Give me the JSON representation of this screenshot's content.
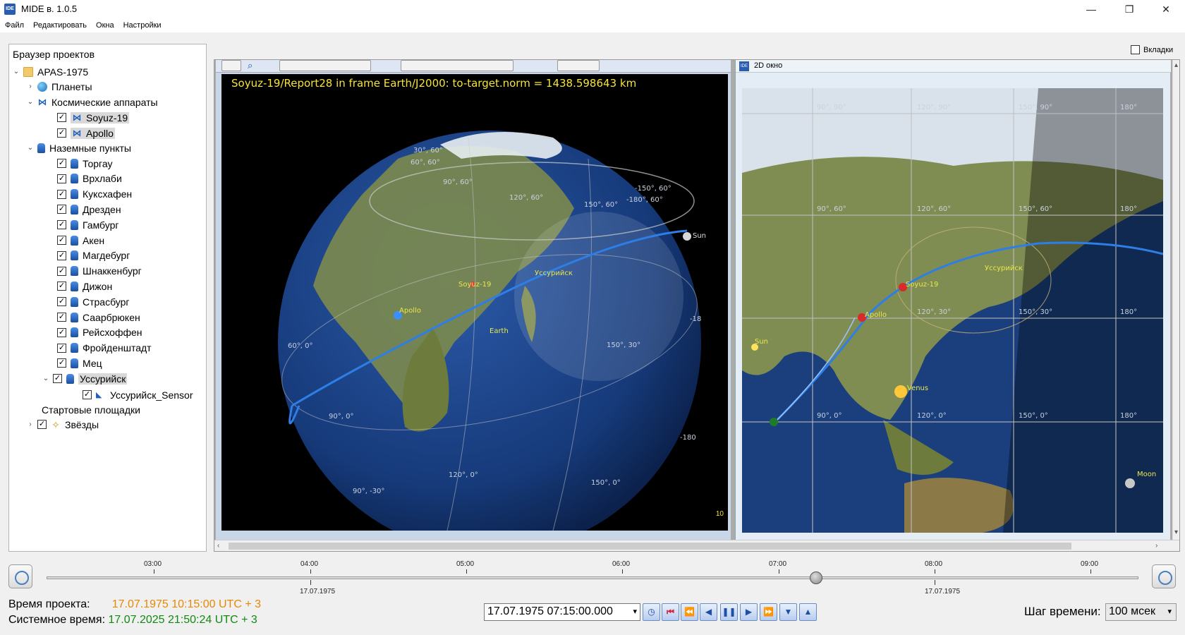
{
  "window": {
    "title": "MIDE в. 1.0.5",
    "app_icon": "IDE",
    "minimize": "—",
    "maximize": "❐",
    "close": "✕"
  },
  "menu": {
    "items": [
      "Файл",
      "Редактировать",
      "Окна",
      "Настройки"
    ]
  },
  "project_browser": {
    "title": "Браузер проектов",
    "project": "APAS-1975",
    "planets": "Планеты",
    "spacecraft_group": "Космические аппараты",
    "spacecraft": [
      "Soyuz-19",
      "Apollo"
    ],
    "ground_group": "Наземные пункты",
    "ground_stations": [
      "Торгау",
      "Врхлаби",
      "Куксхафен",
      "Дрезден",
      "Гамбург",
      "Акен",
      "Магдебург",
      "Шнаккенбург",
      "Дижон",
      "Страсбург",
      "Саарбрюкен",
      "Рейсхоффен",
      "Фройденштадт",
      "Мец",
      "Уссурийск"
    ],
    "sensor": "Уссурийск_Sensor",
    "launch_sites": "Стартовые площадки",
    "stars": "Звёзды",
    "check": "✓"
  },
  "tabs_checkbox": "Вкладки",
  "view3d": {
    "overlay": "Soyuz-19/Report28 in frame Earth/J2000: to-target.norm = 1438.598643 km",
    "frame_count": "10",
    "labels": {
      "soyuz": "Soyuz-19",
      "apollo": "Apollo",
      "ussuriysk": "Уссурийск",
      "earth": "Earth",
      "sun": "Sun",
      "g1": "30°, 60°",
      "g2": "60°, 60°",
      "g3": "90°, 60°",
      "g4": "120°, 60°",
      "g5": "150°, 60°",
      "g6": "-150°, 60°",
      "g7": "-180°, 60°",
      "g8": "60°, 0°",
      "g9": "90°, 0°",
      "g10": "120°, 0°",
      "g11": "150°, 30°",
      "g12": "90°, -30°",
      "g13": "150°, 0°",
      "g14": "-180",
      "g15": "-18"
    }
  },
  "view2d": {
    "title": "2D окно",
    "labels": {
      "soyuz": "Soyuz-19",
      "apollo": "Apollo",
      "ussuriysk": "Уссурийск",
      "sun": "Sun",
      "venus": "Venus",
      "moon": "Moon"
    },
    "grid": {
      "a1": "90°, 90°",
      "a2": "120°, 90°",
      "a3": "150°, 90°",
      "a4": "180°",
      "b1": "90°, 60°",
      "b2": "120°, 60°",
      "b3": "150°, 60°",
      "b4": "180°",
      "c1": "120°, 30°",
      "c2": "150°, 30°",
      "c3": "180°",
      "d1": "90°, 0°",
      "d2": "120°, 0°",
      "d3": "150°, 0°",
      "d4": "180°"
    }
  },
  "timeline": {
    "ticks": [
      "03:00",
      "04:00",
      "05:00",
      "06:00",
      "07:00",
      "08:00",
      "09:00"
    ],
    "dates": [
      "17.07.1975",
      "17.07.1975"
    ]
  },
  "status": {
    "project_time_label": "Время проекта:",
    "project_time_value": "17.07.1975 10:15:00 UTC + 3",
    "system_time_label": "Системное время:",
    "system_time_value": "17.07.2025 21:50:24 UTC + 3"
  },
  "controls": {
    "datetime": "17.07.1975 07:15:00.000",
    "step_label": "Шаг времени:",
    "step_value": "100 мсек",
    "dropdown": "▾"
  },
  "colors": {
    "overlay_text": "#f6e33a",
    "orbit": "#2d7ee6",
    "project_time": "#e88800",
    "system_time": "#128a12"
  }
}
